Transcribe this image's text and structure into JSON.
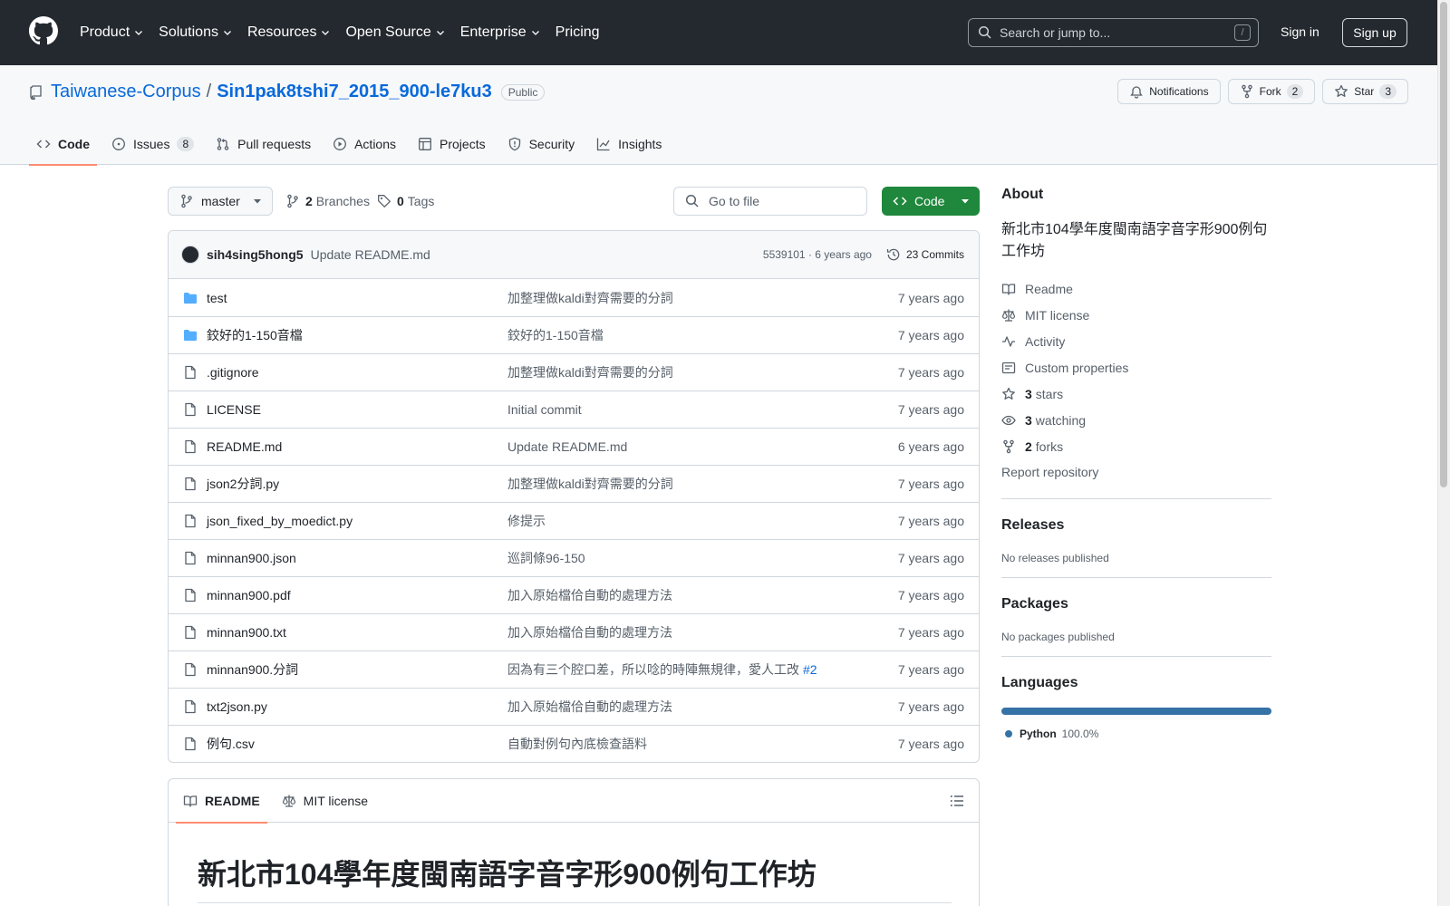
{
  "header": {
    "nav": [
      {
        "label": "Product",
        "has_caret": true
      },
      {
        "label": "Solutions",
        "has_caret": true
      },
      {
        "label": "Resources",
        "has_caret": true
      },
      {
        "label": "Open Source",
        "has_caret": true
      },
      {
        "label": "Enterprise",
        "has_caret": true
      },
      {
        "label": "Pricing",
        "has_caret": false
      }
    ],
    "search_placeholder": "Search or jump to...",
    "search_shortcut": "/",
    "sign_in": "Sign in",
    "sign_up": "Sign up"
  },
  "repo": {
    "owner": "Taiwanese-Corpus",
    "separator": "/",
    "name": "Sin1pak8tshi7_2015_900-le7ku3",
    "visibility": "Public",
    "actions": {
      "notifications": "Notifications",
      "fork": "Fork",
      "fork_count": "2",
      "star": "Star",
      "star_count": "3"
    },
    "tabs": [
      {
        "label": "Code",
        "icon": "code-icon",
        "active": true
      },
      {
        "label": "Issues",
        "icon": "issue-icon",
        "count": "8"
      },
      {
        "label": "Pull requests",
        "icon": "pull-request-icon"
      },
      {
        "label": "Actions",
        "icon": "play-icon"
      },
      {
        "label": "Projects",
        "icon": "table-icon"
      },
      {
        "label": "Security",
        "icon": "shield-icon"
      },
      {
        "label": "Insights",
        "icon": "graph-icon"
      }
    ]
  },
  "toolbar": {
    "branch": "master",
    "branches_count": "2",
    "branches_label": "Branches",
    "tags_count": "0",
    "tags_label": "Tags",
    "goto_placeholder": "Go to file",
    "code_button": "Code"
  },
  "latest_commit": {
    "author": "sih4sing5hong5",
    "message": "Update README.md",
    "hash_and_time": "5539101 · 6 years ago",
    "commits_label": "23 Commits"
  },
  "files": [
    {
      "type": "dir",
      "name": "test",
      "message": "加整理做kaldi對齊需要的分詞",
      "date": "7 years ago"
    },
    {
      "type": "dir",
      "name": "鉸好的1-150音檔",
      "message": "鉸好的1-150音檔",
      "date": "7 years ago"
    },
    {
      "type": "file",
      "name": ".gitignore",
      "message": "加整理做kaldi對齊需要的分詞",
      "date": "7 years ago"
    },
    {
      "type": "file",
      "name": "LICENSE",
      "message": "Initial commit",
      "date": "7 years ago"
    },
    {
      "type": "file",
      "name": "README.md",
      "message": "Update README.md",
      "date": "6 years ago"
    },
    {
      "type": "file",
      "name": "json2分詞.py",
      "message": "加整理做kaldi對齊需要的分詞",
      "date": "7 years ago"
    },
    {
      "type": "file",
      "name": "json_fixed_by_moedict.py",
      "message": "修提示",
      "date": "7 years ago"
    },
    {
      "type": "file",
      "name": "minnan900.json",
      "message": "巡詞條96-150",
      "date": "7 years ago"
    },
    {
      "type": "file",
      "name": "minnan900.pdf",
      "message": "加入原始檔佮自動的處理方法",
      "date": "7 years ago"
    },
    {
      "type": "file",
      "name": "minnan900.txt",
      "message": "加入原始檔佮自動的處理方法",
      "date": "7 years ago"
    },
    {
      "type": "file",
      "name": "minnan900.分詞",
      "message": "因為有三个腔口差，所以唸的時陣無規律，愛人工改",
      "issue": "#2",
      "date": "7 years ago"
    },
    {
      "type": "file",
      "name": "txt2json.py",
      "message": "加入原始檔佮自動的處理方法",
      "date": "7 years ago"
    },
    {
      "type": "file",
      "name": "例句.csv",
      "message": "自動對例句內底檢查語料",
      "date": "7 years ago"
    }
  ],
  "readme": {
    "tab_readme": "README",
    "tab_license": "MIT license",
    "heading": "新北市104學年度閩南語字音字形900例句工作坊"
  },
  "about": {
    "title": "About",
    "description": "新北市104學年度閩南語字音字形900例句工作坊",
    "links": [
      {
        "icon": "book-icon",
        "label": "Readme"
      },
      {
        "icon": "law-icon",
        "label": "MIT license"
      },
      {
        "icon": "pulse-icon",
        "label": "Activity"
      },
      {
        "icon": "note-icon",
        "label": "Custom properties"
      },
      {
        "icon": "star-icon",
        "count": "3",
        "label": "stars"
      },
      {
        "icon": "eye-icon",
        "count": "3",
        "label": "watching"
      },
      {
        "icon": "fork-icon",
        "count": "2",
        "label": "forks"
      }
    ],
    "report": "Report repository"
  },
  "releases": {
    "title": "Releases",
    "note": "No releases published"
  },
  "packages": {
    "title": "Packages",
    "note": "No packages published"
  },
  "languages": {
    "title": "Languages",
    "items": [
      {
        "name": "Python",
        "percent": "100.0%",
        "share": 1.0,
        "color": "#3572A5"
      }
    ]
  },
  "colors": {
    "header_bg": "#24292f",
    "link": "#0969da",
    "accent_tab": "#fd8c73",
    "primary_button": "#1f883d",
    "folder": "#54aeff"
  }
}
